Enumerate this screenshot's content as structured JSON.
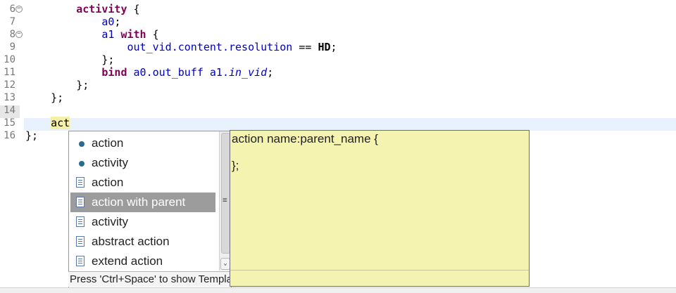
{
  "editor": {
    "lines": [
      {
        "num": "6",
        "fold": "⊖",
        "segments": [
          {
            "t": "        ",
            "c": "plain"
          },
          {
            "t": "activity",
            "c": "kw"
          },
          {
            "t": " {",
            "c": "plain"
          }
        ]
      },
      {
        "num": "7",
        "fold": "",
        "segments": [
          {
            "t": "            ",
            "c": "plain"
          },
          {
            "t": "a0",
            "c": "id"
          },
          {
            "t": ";",
            "c": "plain"
          }
        ]
      },
      {
        "num": "8",
        "fold": "⊖",
        "segments": [
          {
            "t": "            ",
            "c": "plain"
          },
          {
            "t": "a1",
            "c": "id"
          },
          {
            "t": " ",
            "c": "plain"
          },
          {
            "t": "with",
            "c": "kw"
          },
          {
            "t": " {",
            "c": "plain"
          }
        ]
      },
      {
        "num": "9",
        "fold": "",
        "segments": [
          {
            "t": "                ",
            "c": "plain"
          },
          {
            "t": "out_vid.content.resolution",
            "c": "id"
          },
          {
            "t": " == ",
            "c": "plain"
          },
          {
            "t": "HD",
            "c": "bold"
          },
          {
            "t": ";",
            "c": "plain"
          }
        ]
      },
      {
        "num": "10",
        "fold": "",
        "segments": [
          {
            "t": "            };",
            "c": "plain"
          }
        ]
      },
      {
        "num": "11",
        "fold": "",
        "segments": [
          {
            "t": "            ",
            "c": "plain"
          },
          {
            "t": "bind",
            "c": "kw"
          },
          {
            "t": " ",
            "c": "plain"
          },
          {
            "t": "a0.out_buff",
            "c": "id"
          },
          {
            "t": " ",
            "c": "plain"
          },
          {
            "t": "a1.",
            "c": "id"
          },
          {
            "t": "in_vid",
            "c": "idi"
          },
          {
            "t": ";",
            "c": "plain"
          }
        ]
      },
      {
        "num": "12",
        "fold": "",
        "segments": [
          {
            "t": "        };",
            "c": "plain"
          }
        ]
      },
      {
        "num": "13",
        "fold": "",
        "segments": [
          {
            "t": "    };",
            "c": "plain"
          }
        ]
      },
      {
        "num": "14",
        "fold": "",
        "segments": []
      },
      {
        "num": "15",
        "fold": "",
        "segments": [
          {
            "t": "    ",
            "c": "plain"
          },
          {
            "t": "act",
            "c": "plain acttext"
          }
        ]
      },
      {
        "num": "16",
        "fold": "",
        "segments": [
          {
            "t": "};",
            "c": "plain"
          }
        ]
      }
    ]
  },
  "completion": {
    "items": [
      {
        "label": "action",
        "icon": "keyword-dot-icon"
      },
      {
        "label": "activity",
        "icon": "keyword-dot-icon"
      },
      {
        "label": "action",
        "icon": "template-icon"
      },
      {
        "label": "action with parent",
        "icon": "template-icon",
        "selected": true
      },
      {
        "label": "activity",
        "icon": "template-icon"
      },
      {
        "label": "abstract action",
        "icon": "template-icon"
      },
      {
        "label": "extend action",
        "icon": "template-icon"
      }
    ],
    "status": "Press 'Ctrl+Space' to show Template Proposals"
  },
  "info": {
    "lines": [
      "action name:parent_name {",
      "",
      "};"
    ]
  }
}
